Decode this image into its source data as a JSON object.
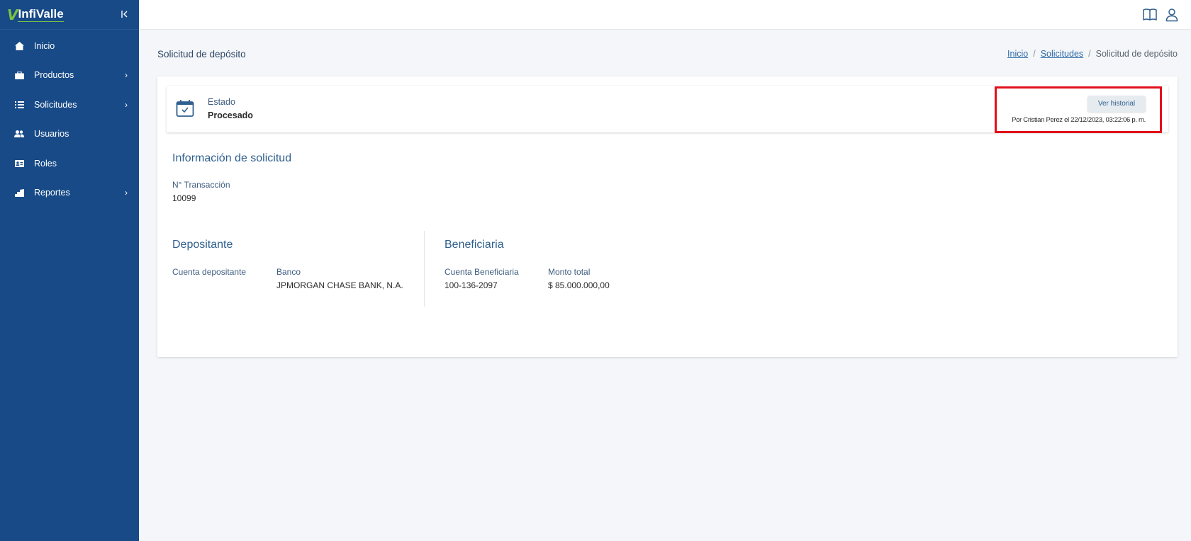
{
  "brand": {
    "logo_mark": "V",
    "logo_text": "InfiValle"
  },
  "sidebar": {
    "collapse_icon": "collapse-left-icon",
    "items": [
      {
        "label": "Inicio",
        "icon": "home-icon",
        "has_children": false
      },
      {
        "label": "Productos",
        "icon": "briefcase-icon",
        "has_children": true
      },
      {
        "label": "Solicitudes",
        "icon": "list-icon",
        "has_children": true
      },
      {
        "label": "Usuarios",
        "icon": "users-icon",
        "has_children": false
      },
      {
        "label": "Roles",
        "icon": "id-card-icon",
        "has_children": false
      },
      {
        "label": "Reportes",
        "icon": "chart-icon",
        "has_children": true
      }
    ],
    "chevron": "›"
  },
  "topbar": {
    "icons": [
      "book-icon",
      "user-icon"
    ]
  },
  "page": {
    "title": "Solicitud de depósito",
    "breadcrumb": {
      "home": "Inicio",
      "parent": "Solicitudes",
      "current": "Solicitud de depósito",
      "separator": "/"
    }
  },
  "status": {
    "label": "Estado",
    "value": "Procesado",
    "history_button": "Ver historial",
    "history_meta": "Por Cristian Perez el 22/12/2023, 03:22:06 p. m."
  },
  "request_info": {
    "title": "Información de solicitud",
    "transaction_label": "N° Transacción",
    "transaction_value": "10099"
  },
  "depositor": {
    "title": "Depositante",
    "account_label": "Cuenta depositante",
    "account_value": "",
    "bank_label": "Banco",
    "bank_value": "JPMORGAN CHASE BANK, N.A."
  },
  "beneficiary": {
    "title": "Beneficiaria",
    "account_label": "Cuenta Beneficiaria",
    "account_value": "100-136-2097",
    "amount_label": "Monto total",
    "amount_value": "$ 85.000.000,00"
  },
  "colors": {
    "sidebar": "#174a87",
    "accent": "#2f5f8e",
    "highlight": "#e3101a",
    "logo_green": "#7cc242"
  }
}
